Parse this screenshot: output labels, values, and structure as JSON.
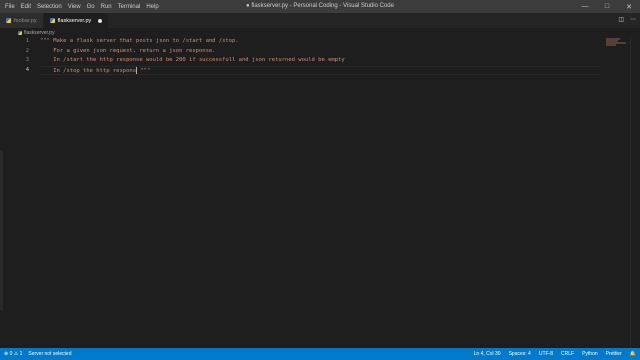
{
  "titlebar": {
    "menu": [
      "File",
      "Edit",
      "Selection",
      "View",
      "Go",
      "Run",
      "Terminal",
      "Help"
    ],
    "title": "● flaskserver.py - Personal Coding - Visual Studio Code",
    "minimize_icon": "minimize-icon",
    "maximize_icon": "maximize-icon",
    "close_icon": "close-icon"
  },
  "tabs": [
    {
      "label": "foobar.py",
      "active": false,
      "icon": "python-icon"
    },
    {
      "label": "flaskserver.py",
      "active": true,
      "icon": "python-icon",
      "modified": true
    }
  ],
  "breadcrumb": {
    "file": "flaskserver.py"
  },
  "editor": {
    "line_numbers": [
      "1",
      "2",
      "3",
      "4"
    ],
    "lines": [
      "\"\"\" Make a flask server that posts json to /start and /stop.",
      "    For a given json request, return a json response.",
      "    In /start the http response would be 200 if successfull and json returned would be empty",
      "    In /stop the http respons \"\"\""
    ],
    "current_line": 4
  },
  "statusbar": {
    "problems": "⊗ 0 ⚠ 1",
    "server": "Server not selected",
    "position": "Ln 4, Col 30",
    "spaces": "Spaces: 4",
    "encoding": "UTF-8",
    "eol": "CRLF",
    "language": "Python",
    "formatter": "Prettier"
  },
  "colors": {
    "statusbar": "#007acc",
    "string": "#ce9178",
    "editor_bg": "#1e1e1e",
    "titlebar": "#3c3c3c"
  }
}
